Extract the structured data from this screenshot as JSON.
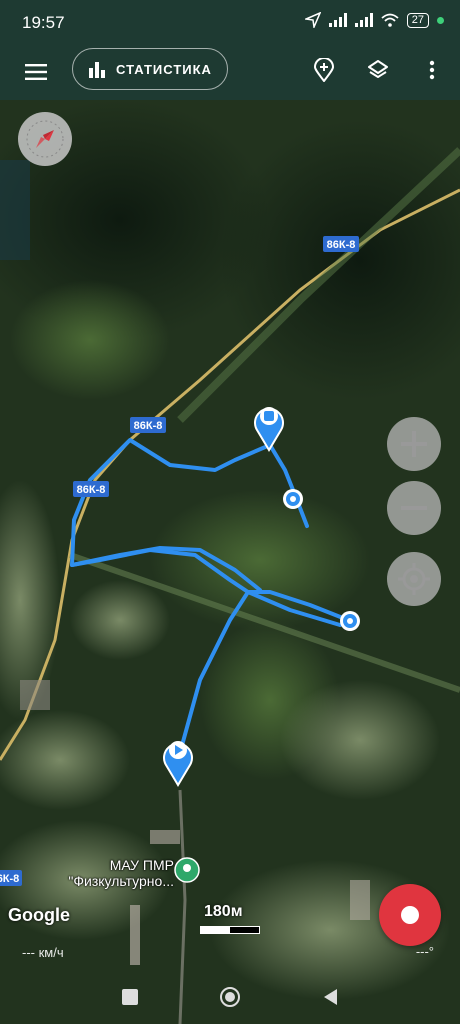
{
  "status_bar": {
    "time": "19:57",
    "battery": "27"
  },
  "top_bar": {
    "stats_label": "СТАТИСТИКА"
  },
  "map": {
    "road_labels": [
      "86К-8",
      "86К-8",
      "86К-8",
      "6К-8"
    ],
    "poi": {
      "line1": "МАУ ПМР",
      "line2": "\"Физкультурно..."
    },
    "google_label": "Google",
    "scale_label": "180м"
  },
  "bottom": {
    "speed": "--- км/ч",
    "heading": "---°"
  },
  "colors": {
    "track": "#2f8ff0",
    "record": "#e0353f",
    "bars": "#1e3a32"
  }
}
